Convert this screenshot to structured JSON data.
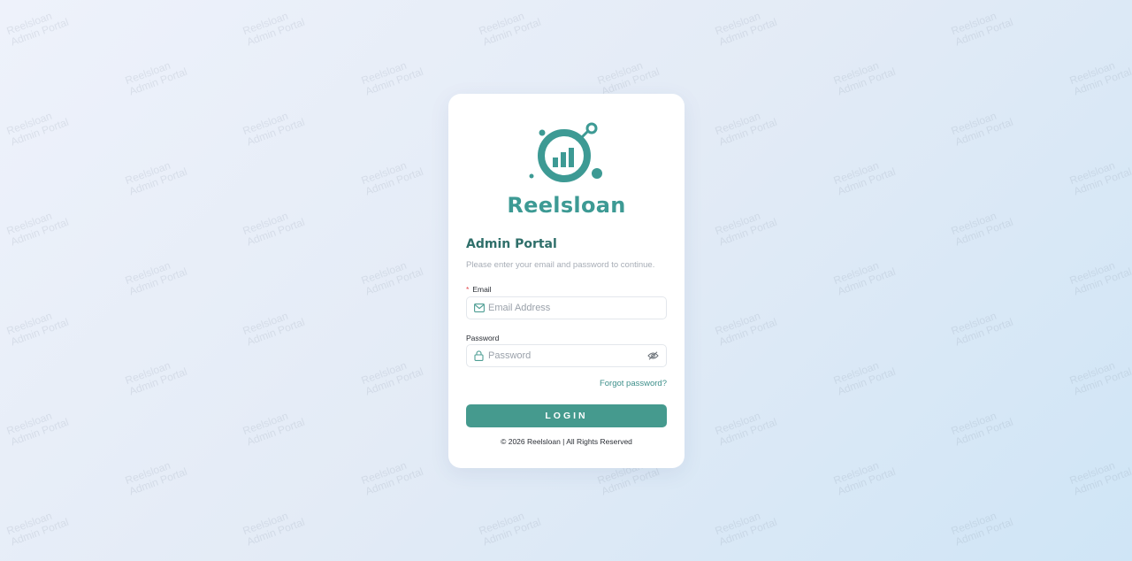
{
  "watermark": {
    "line1": "Reelsloan",
    "line2": "Admin Portal"
  },
  "brand": {
    "name": "Reelsloan",
    "color": "#3d9a94"
  },
  "form": {
    "title": "Admin Portal",
    "subtitle": "Please enter your email and password to continue.",
    "email": {
      "required_mark": "*",
      "label": "Email",
      "placeholder": "Email Address",
      "value": "",
      "icon": "mail-icon"
    },
    "password": {
      "label": "Password",
      "placeholder": "Password",
      "value": "",
      "icon": "lock-icon",
      "toggle_icon": "eye-off-icon"
    },
    "forgot_label": "Forgot password?",
    "login_label": "LOGIN",
    "login_color": "#459a8e"
  },
  "footer": {
    "copyright": "© 2026 Reelsloan |  All Rights Reserved"
  }
}
